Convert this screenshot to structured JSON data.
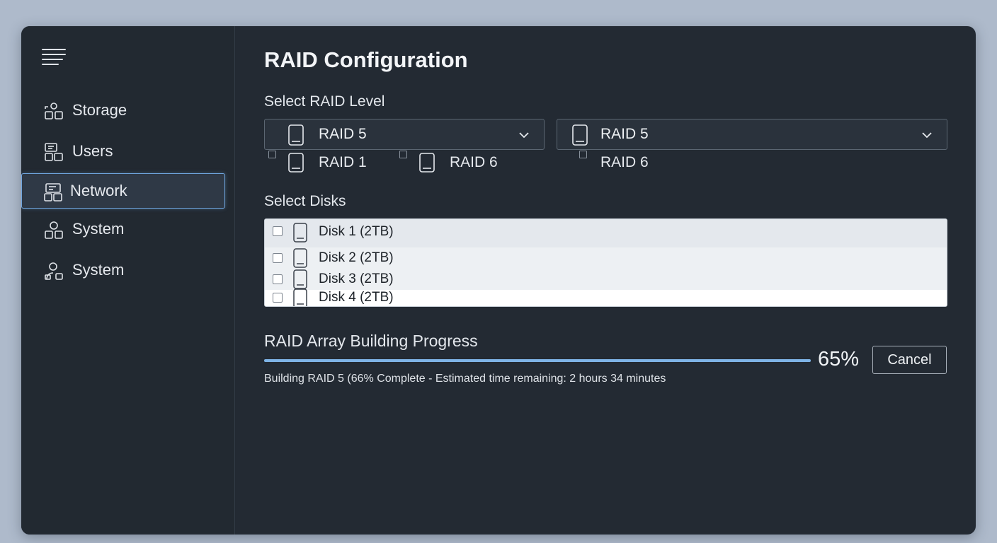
{
  "sidebar": {
    "menu_icon": "hamburger-menu-icon",
    "items": [
      {
        "label": "Storage",
        "icon": "storage-icon",
        "active": false
      },
      {
        "label": "Users",
        "icon": "users-icon",
        "active": false
      },
      {
        "label": "Network",
        "icon": "network-icon",
        "active": true
      },
      {
        "label": "System",
        "icon": "system-icon",
        "active": false
      },
      {
        "label": "System",
        "icon": "system-user-icon",
        "active": false
      }
    ]
  },
  "main": {
    "title": "RAID Configuration",
    "raid_level": {
      "label": "Select RAID Level",
      "dropdowns": [
        {
          "value": "RAID 5",
          "icon": "drive-icon"
        },
        {
          "value": "RAID 5",
          "icon": "drive-icon"
        }
      ],
      "options": [
        {
          "label": "RAID 1"
        },
        {
          "label": "RAID 6"
        },
        {
          "label": "RAID 6"
        }
      ]
    },
    "disks": {
      "label": "Select Disks",
      "items": [
        {
          "label": "Disk 1 (2TB)",
          "checked": false
        },
        {
          "label": "Disk 2 (2TB)",
          "checked": false
        },
        {
          "label": "Disk 3 (2TB)",
          "checked": false
        },
        {
          "label": "Disk 4 (2TB)",
          "checked": false
        }
      ]
    },
    "progress": {
      "label": "RAID Array Building Progress",
      "percent_value": 65,
      "percent_text": "65%",
      "cancel_label": "Cancel",
      "status_text": "Building RAID 5 (66% Complete - Estimated time remaining: 2 hours 34 minutes"
    }
  },
  "colors": {
    "accent": "#6fa5de",
    "progress_fill": "#7eb3e6",
    "window_bg": "#232a33",
    "page_bg": "#aebacb"
  }
}
